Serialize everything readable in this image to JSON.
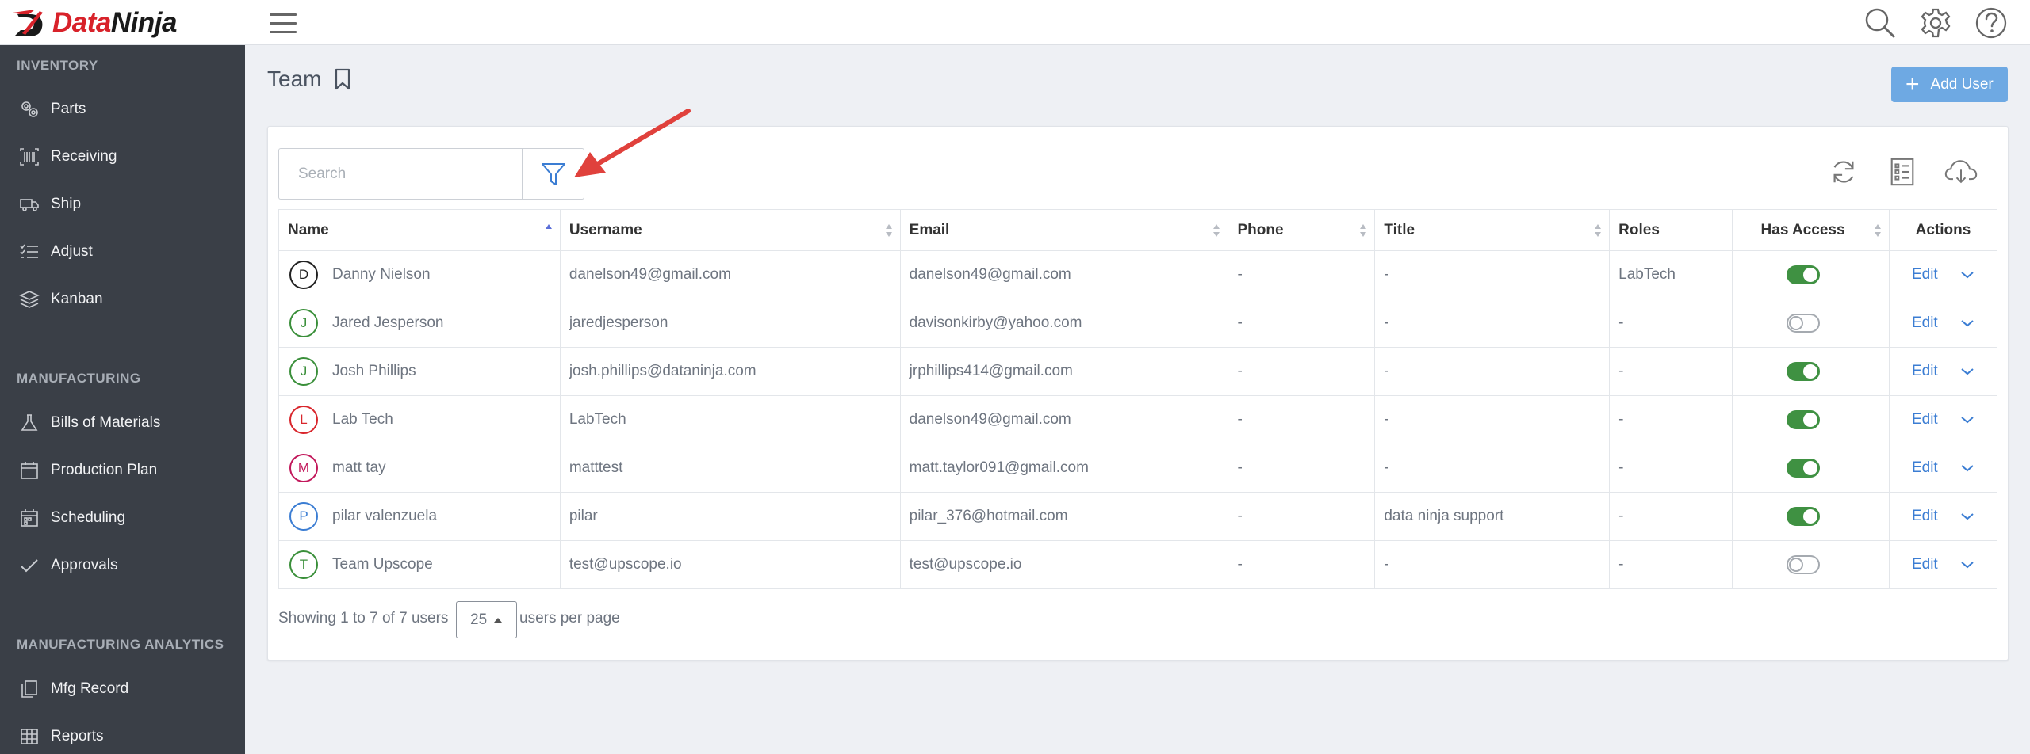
{
  "brand": {
    "name_part1": "Data",
    "name_part2": "Ninja"
  },
  "sidebar": {
    "sections": [
      {
        "title": "INVENTORY",
        "items": [
          {
            "label": "Parts",
            "icon": "gears-icon"
          },
          {
            "label": "Receiving",
            "icon": "barcode-icon"
          },
          {
            "label": "Ship",
            "icon": "truck-icon"
          },
          {
            "label": "Adjust",
            "icon": "checklist-icon"
          },
          {
            "label": "Kanban",
            "icon": "layers-icon"
          }
        ]
      },
      {
        "title": "MANUFACTURING",
        "items": [
          {
            "label": "Bills of Materials",
            "icon": "flask-icon"
          },
          {
            "label": "Production Plan",
            "icon": "calendar-icon"
          },
          {
            "label": "Scheduling",
            "icon": "calendar-grid-icon"
          },
          {
            "label": "Approvals",
            "icon": "checkmark-icon"
          }
        ]
      },
      {
        "title": "MANUFACTURING ANALYTICS",
        "items": [
          {
            "label": "Mfg Record",
            "icon": "copy-icon"
          },
          {
            "label": "Reports",
            "icon": "table-icon"
          }
        ]
      }
    ]
  },
  "page": {
    "title": "Team",
    "add_button": "Add User"
  },
  "search": {
    "placeholder": "Search"
  },
  "table": {
    "columns": [
      "Name",
      "Username",
      "Email",
      "Phone",
      "Title",
      "Roles",
      "Has Access",
      "Actions"
    ],
    "rows": [
      {
        "initial": "D",
        "color": "#222222",
        "name": "Danny Nielson",
        "username": "danelson49@gmail.com",
        "email": "danelson49@gmail.com",
        "phone": "-",
        "title": "-",
        "roles": "LabTech",
        "access": true,
        "action": "Edit"
      },
      {
        "initial": "J",
        "color": "#3a8f3a",
        "name": "Jared Jesperson",
        "username": "jaredjesperson",
        "email": "davisonkirby@yahoo.com",
        "phone": "-",
        "title": "-",
        "roles": "-",
        "access": false,
        "action": "Edit"
      },
      {
        "initial": "J",
        "color": "#3a8f3a",
        "name": "Josh Phillips",
        "username": "josh.phillips@dataninja.com",
        "email": "jrphillips414@gmail.com",
        "phone": "-",
        "title": "-",
        "roles": "-",
        "access": true,
        "action": "Edit"
      },
      {
        "initial": "L",
        "color": "#d9262c",
        "name": "Lab Tech",
        "username": "LabTech",
        "email": "danelson49@gmail.com",
        "phone": "-",
        "title": "-",
        "roles": "-",
        "access": true,
        "action": "Edit"
      },
      {
        "initial": "M",
        "color": "#c2185b",
        "name": "matt tay",
        "username": "matttest",
        "email": "matt.taylor091@gmail.com",
        "phone": "-",
        "title": "-",
        "roles": "-",
        "access": true,
        "action": "Edit"
      },
      {
        "initial": "P",
        "color": "#3b7dd3",
        "name": "pilar valenzuela",
        "username": "pilar",
        "email": "pilar_376@hotmail.com",
        "phone": "-",
        "title": "data ninja support",
        "roles": "-",
        "access": true,
        "action": "Edit"
      },
      {
        "initial": "T",
        "color": "#3a8f3a",
        "name": "Team Upscope",
        "username": "test@upscope.io",
        "email": "test@upscope.io",
        "phone": "-",
        "title": "-",
        "roles": "-",
        "access": false,
        "action": "Edit"
      }
    ]
  },
  "footer": {
    "showing": "Showing 1 to 7 of 7 users",
    "per_page_value": "25",
    "per_page_label": "users per page"
  }
}
